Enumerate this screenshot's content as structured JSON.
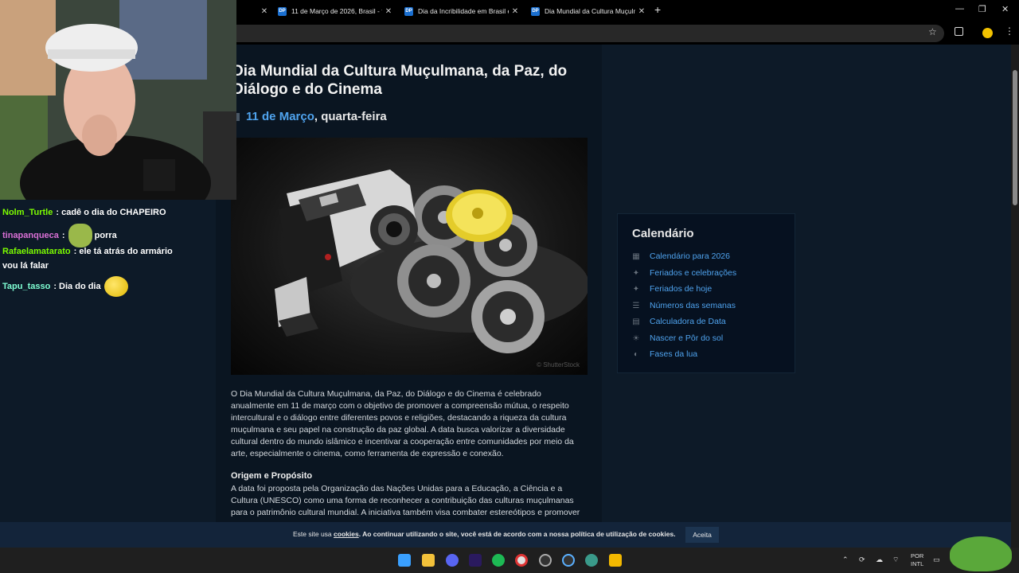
{
  "browser": {
    "tabs": [
      {
        "favicon": "DP",
        "title": "11 de Março de 2026, Brasil - fe"
      },
      {
        "favicon": "DP",
        "title": "Dia da Incribilidade em Brasil en"
      },
      {
        "favicon": "DP",
        "title": "Dia Mundial da Cultura Muçulma"
      }
    ],
    "url": "/"
  },
  "chat": {
    "messages": [
      {
        "user": "Nolm_Turtle",
        "color": "#7cfc00",
        "text": "cadê o dia do CHAPEIRO",
        "emote": null
      },
      {
        "user": "tinapanqueca",
        "color": "#da70d6",
        "text": "porra",
        "emote": "green-creature"
      },
      {
        "user": "Rafaelamatarato",
        "color": "#7cfc00",
        "text": "ele tá atrás do armário",
        "text2": "vou lá falar",
        "emote": null
      },
      {
        "user": "Tapu_tasso",
        "color": "#7fffd4",
        "text": "Dia do dia",
        "emote": "smiley"
      }
    ]
  },
  "article": {
    "title": "Dia Mundial da Cultura Muçulmana, da Paz, do Diálogo e do Cinema",
    "date_link": "11 de Março",
    "weekday": ", quarta-feira",
    "image_credit": "© ShutterStock",
    "intro_lines": [
      "O Dia Mundial da Cultura Muçulmana, da Paz, do Diálogo e do Cinema é celebrado",
      "anualmente em 11 de março com o objetivo de promover a compreensão mútua, o respeito",
      "intercultural e o diálogo entre diferentes povos e religiões, destacando a riqueza da cultura",
      "muçulmana e seu papel na construção da paz global. A data busca valorizar a diversidade",
      "cultural dentro do mundo islâmico e incentivar a cooperação entre comunidades por meio da",
      "arte, especialmente o cinema, como ferramenta de expressão e conexão."
    ],
    "section_heading": "Origem e Propósito",
    "section_lines": [
      "A data foi proposta pela Organização das Nações Unidas para a Educação, a Ciência e a",
      "Cultura (UNESCO) como uma forma de reconhecer a contribuição das culturas muçulmanas",
      "para o patrimônio cultural mundial. A iniciativa também visa combater estereótipos e promover"
    ]
  },
  "sidebar": {
    "title": "Calendário",
    "items": [
      {
        "icon": "calendar-icon",
        "label": "Calendário para 2026"
      },
      {
        "icon": "sparkle-icon",
        "label": "Feriados e celebrações"
      },
      {
        "icon": "sparkle-icon",
        "label": "Feriados de hoje"
      },
      {
        "icon": "list-icon",
        "label": "Números das semanas"
      },
      {
        "icon": "calculator-icon",
        "label": "Calculadora de Data"
      },
      {
        "icon": "sunrise-icon",
        "label": "Nascer e Pôr do sol"
      },
      {
        "icon": "moon-icon",
        "label": "Fases da lua"
      }
    ]
  },
  "cookie": {
    "prefix": "Este site usa ",
    "link": "cookies",
    "suffix": ". Ao continuar utilizando o site, você está de acordo com a nossa política de utilização de cookies.",
    "accept": "Aceita"
  },
  "taskbar": {
    "lang_top": "POR",
    "lang_bottom": "INTL"
  },
  "colors": {
    "link": "#4fa3ee",
    "page_bg": "#0d1a28",
    "card_bg": "#061120"
  }
}
